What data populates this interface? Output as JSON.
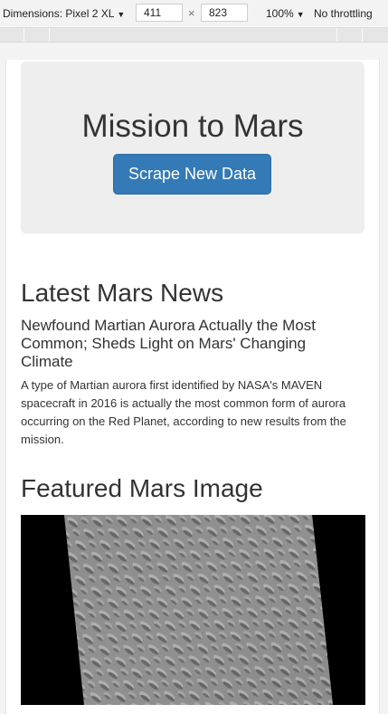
{
  "devtools": {
    "device_label": "Dimensions: Pixel 2 XL",
    "width": "411",
    "height": "823",
    "zoom": "100%",
    "throttle": "No throttling",
    "times_sign": "×"
  },
  "jumbotron": {
    "title": "Mission to Mars",
    "button_label": "Scrape New Data",
    "button_color": "#337ab7"
  },
  "news": {
    "heading": "Latest Mars News",
    "title": "Newfound Martian Aurora Actually the Most Common; Sheds Light on Mars' Changing Climate",
    "body": "A type of Martian aurora first identified by NASA's MAVEN spacecraft in 2016 is actually the most common form of aurora occurring on the Red Planet, according to new results from the mission."
  },
  "featured": {
    "heading": "Featured Mars Image",
    "image_icon": "mars-dunes-image"
  }
}
